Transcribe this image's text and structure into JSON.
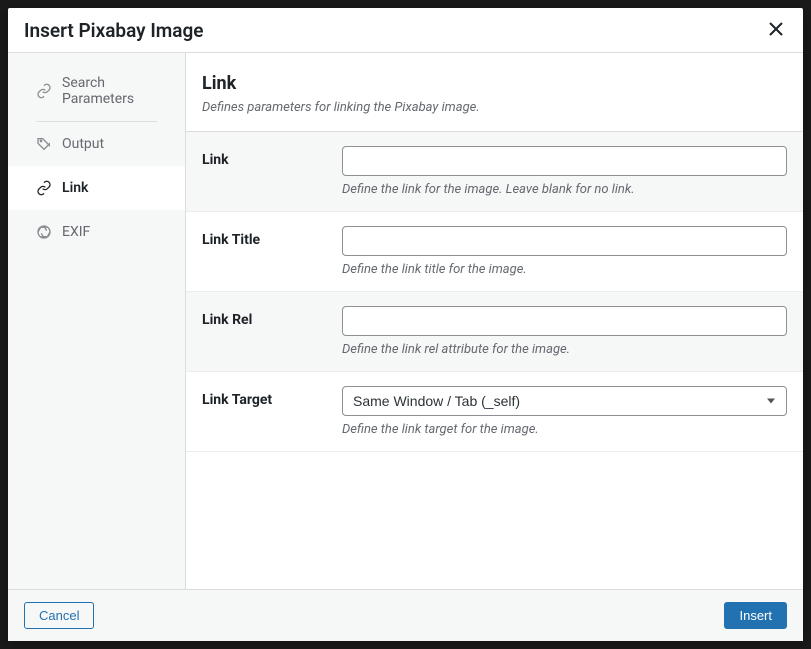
{
  "modal": {
    "title": "Insert Pixabay Image"
  },
  "sidebar": {
    "items": [
      {
        "label": "Search Parameters"
      },
      {
        "label": "Output"
      },
      {
        "label": "Link"
      },
      {
        "label": "EXIF"
      }
    ]
  },
  "section": {
    "title": "Link",
    "description": "Defines parameters for linking the Pixabay image."
  },
  "fields": {
    "link": {
      "label": "Link",
      "value": "",
      "help": "Define the link for the image. Leave blank for no link."
    },
    "link_title": {
      "label": "Link Title",
      "value": "",
      "help": "Define the link title for the image."
    },
    "link_rel": {
      "label": "Link Rel",
      "value": "",
      "help": "Define the link rel attribute for the image."
    },
    "link_target": {
      "label": "Link Target",
      "selected": "Same Window / Tab (_self)",
      "help": "Define the link target for the image."
    }
  },
  "footer": {
    "cancel": "Cancel",
    "insert": "Insert"
  }
}
